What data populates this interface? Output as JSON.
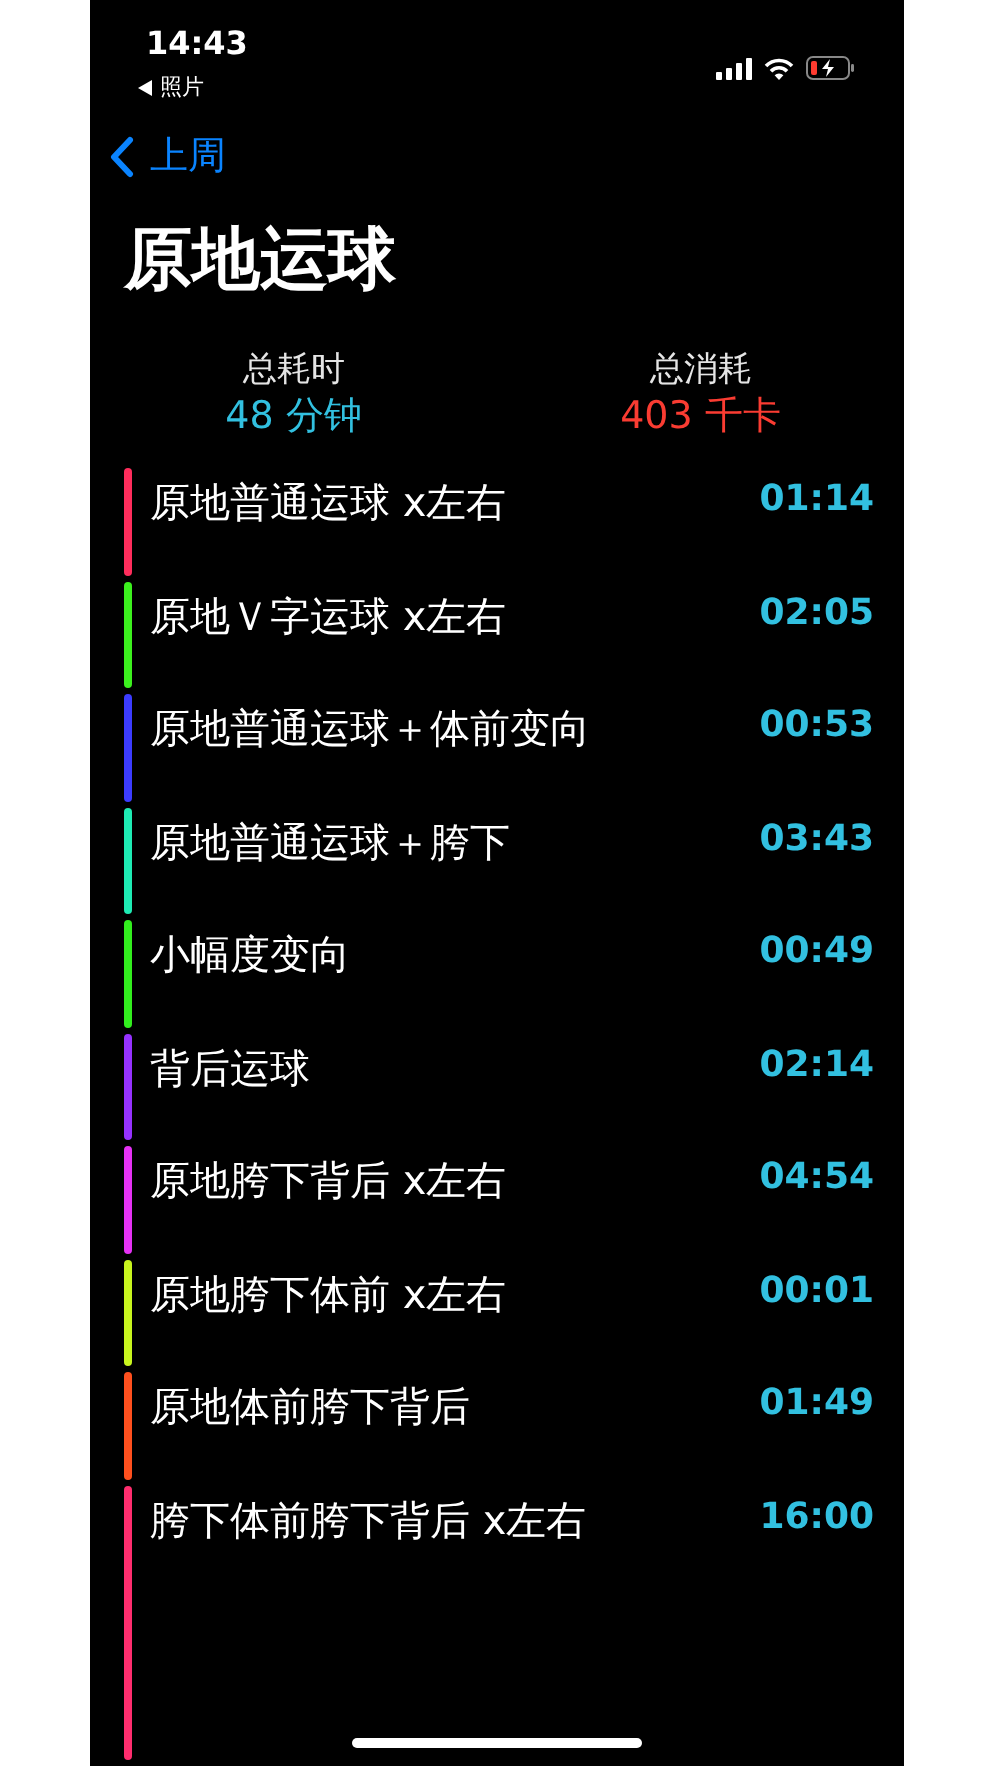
{
  "status_bar": {
    "time": "14:43",
    "back_app": "照片"
  },
  "nav": {
    "back_label": "上周"
  },
  "title": "原地运球",
  "summary": [
    {
      "label": "总耗时",
      "value": "48 分钟",
      "color": "#32c0e0"
    },
    {
      "label": "总消耗",
      "value": "403 千卡",
      "color": "#fa3c32"
    }
  ],
  "drills": [
    {
      "name": "原地普通运球 x左右",
      "time": "01:14",
      "color": "#ff2d5c"
    },
    {
      "name": "原地Ｖ字运球 x左右",
      "time": "02:05",
      "color": "#3cf01e"
    },
    {
      "name": "原地普通运球＋体前变向",
      "time": "00:53",
      "color": "#3c3cff"
    },
    {
      "name": "原地普通运球＋胯下",
      "time": "03:43",
      "color": "#1eebb4"
    },
    {
      "name": "小幅度变向",
      "time": "00:49",
      "color": "#32ee1e"
    },
    {
      "name": "背后运球",
      "time": "02:14",
      "color": "#9632ff"
    },
    {
      "name": "原地胯下背后 x左右",
      "time": "04:54",
      "color": "#e632f5"
    },
    {
      "name": "原地胯下体前 x左右",
      "time": "00:01",
      "color": "#c8f51e"
    },
    {
      "name": "原地体前胯下背后",
      "time": "01:49",
      "color": "#ff501e"
    },
    {
      "name": "胯下体前胯下背后 x左右",
      "time": "16:00",
      "color": "#ff2d6e"
    }
  ]
}
